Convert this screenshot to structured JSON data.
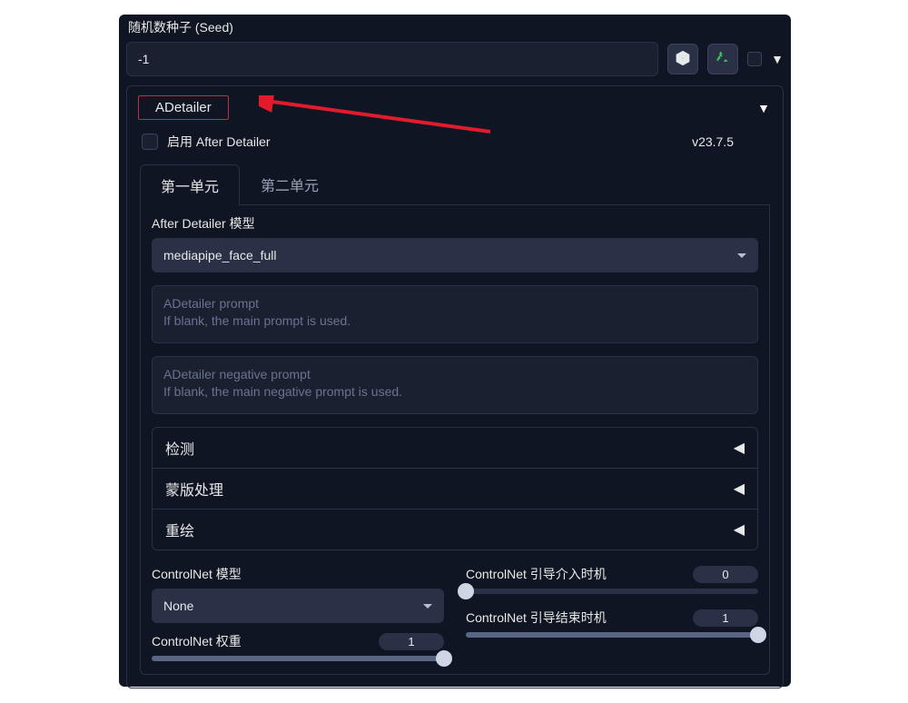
{
  "seed": {
    "label": "随机数种子 (Seed)",
    "value": "-1"
  },
  "adetailer": {
    "title": "ADetailer",
    "enable_label": "启用 After Detailer",
    "version": "v23.7.5",
    "tabs": {
      "unit1": "第一单元",
      "unit2": "第二单元"
    },
    "model": {
      "label": "After Detailer 模型",
      "value": "mediapipe_face_full"
    },
    "prompt": {
      "placeholder_line1": "ADetailer prompt",
      "placeholder_line2": "If blank, the main prompt is used."
    },
    "neg_prompt": {
      "placeholder_line1": "ADetailer negative prompt",
      "placeholder_line2": "If blank, the main negative prompt is used."
    },
    "accordion": {
      "detection": "检测",
      "mask": "蒙版处理",
      "inpaint": "重绘"
    },
    "controlnet": {
      "model_label": "ControlNet 模型",
      "model_value": "None",
      "weight_label": "ControlNet 权重",
      "weight_value": "1",
      "guidance_start_label": "ControlNet 引导介入时机",
      "guidance_start_value": "0",
      "guidance_end_label": "ControlNet 引导结束时机",
      "guidance_end_value": "1"
    }
  }
}
